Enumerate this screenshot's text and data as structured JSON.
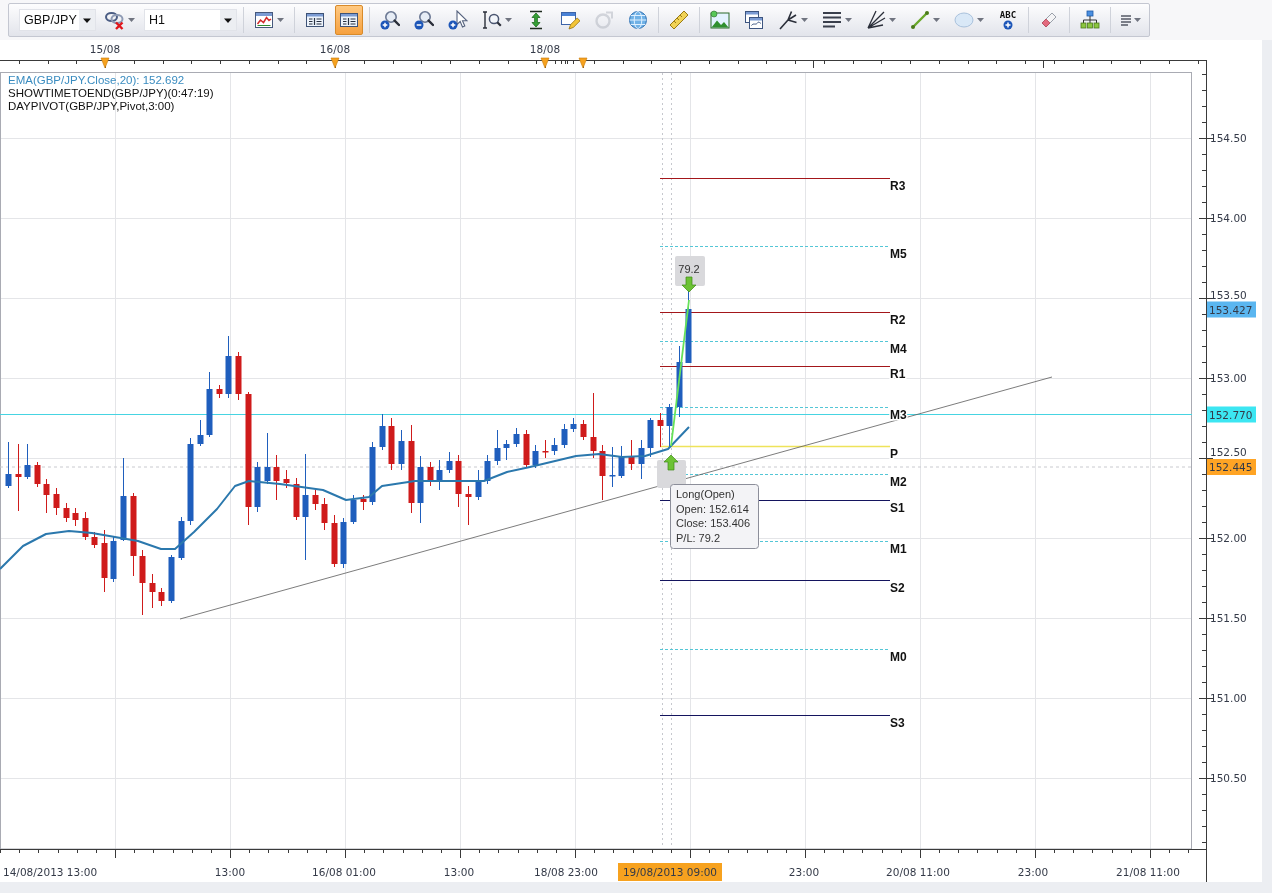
{
  "toolbar": {
    "groups": [
      {
        "items": [
          {
            "kind": "combo",
            "value": "GBP/JPY"
          },
          {
            "kind": "button",
            "on": false,
            "disabled": false,
            "menu": true
          },
          {
            "kind": "combo",
            "value": "H1"
          }
        ]
      },
      {
        "items": [
          {
            "kind": "button",
            "on": false,
            "disabled": false,
            "menu": true
          }
        ]
      },
      {
        "items": [
          {
            "kind": "button",
            "on": false,
            "disabled": false,
            "menu": false
          },
          {
            "kind": "button",
            "on": true,
            "disabled": false,
            "menu": false
          }
        ]
      },
      {
        "items": [
          {
            "kind": "button",
            "on": false,
            "disabled": false,
            "menu": false
          },
          {
            "kind": "button",
            "on": false,
            "disabled": false,
            "menu": false
          },
          {
            "kind": "button",
            "on": false,
            "disabled": false,
            "menu": false
          },
          {
            "kind": "button",
            "on": false,
            "disabled": false,
            "menu": true
          },
          {
            "kind": "button",
            "on": false,
            "disabled": false,
            "menu": false
          },
          {
            "kind": "button",
            "on": false,
            "disabled": false,
            "menu": false
          },
          {
            "kind": "button",
            "on": false,
            "disabled": true,
            "menu": false
          },
          {
            "kind": "button",
            "on": false,
            "disabled": false,
            "menu": false
          }
        ]
      },
      {
        "items": [
          {
            "kind": "button",
            "on": false,
            "disabled": false,
            "menu": false
          }
        ]
      },
      {
        "items": [
          {
            "kind": "button",
            "on": false,
            "disabled": false,
            "menu": false
          },
          {
            "kind": "button",
            "on": false,
            "disabled": false,
            "menu": false
          },
          {
            "kind": "button",
            "on": false,
            "disabled": false,
            "menu": true
          },
          {
            "kind": "button",
            "on": false,
            "disabled": false,
            "menu": true
          },
          {
            "kind": "button",
            "on": false,
            "disabled": false,
            "menu": true
          },
          {
            "kind": "button",
            "on": false,
            "disabled": false,
            "menu": true
          },
          {
            "kind": "button",
            "on": false,
            "disabled": false,
            "menu": true
          },
          {
            "kind": "button",
            "on": false,
            "disabled": false,
            "menu": false,
            "label": "ABC"
          }
        ]
      },
      {
        "items": [
          {
            "kind": "button",
            "on": false,
            "disabled": false,
            "menu": false
          }
        ]
      },
      {
        "items": [
          {
            "kind": "button",
            "on": false,
            "disabled": false,
            "menu": false
          }
        ]
      },
      {
        "items": [
          {
            "kind": "button",
            "on": false,
            "disabled": false,
            "menu": true
          }
        ]
      }
    ]
  },
  "date_ruler": {
    "labels": [
      "15/08",
      "16/08",
      "18/08"
    ]
  },
  "legend": [
    {
      "text": "EMA(GBP/JPY.Close,20): 152.692",
      "color": "#3a8cc0"
    },
    {
      "text": "SHOWTIMETOEND(GBP/JPY)(0:47:19)",
      "color": "#111111"
    },
    {
      "text": "DAYPIVOT(GBP/JPY,Pivot,3:00)",
      "color": "#111111"
    }
  ],
  "pivot_levels": [
    {
      "label": "R3",
      "kind": "resistance"
    },
    {
      "label": "M5",
      "kind": "mid"
    },
    {
      "label": "R2",
      "kind": "resistance"
    },
    {
      "label": "M4",
      "kind": "mid"
    },
    {
      "label": "R1",
      "kind": "resistance"
    },
    {
      "label": "M3",
      "kind": "mid"
    },
    {
      "label": "P",
      "kind": "pivot"
    },
    {
      "label": "M2",
      "kind": "mid"
    },
    {
      "label": "S1",
      "kind": "support"
    },
    {
      "label": "M1",
      "kind": "mid"
    },
    {
      "label": "S2",
      "kind": "support"
    },
    {
      "label": "M0",
      "kind": "mid"
    },
    {
      "label": "S3",
      "kind": "support"
    }
  ],
  "trade": {
    "profit": "79.2",
    "tooltip": [
      "Long(Open)",
      "Open: 152.614",
      "Close: 153.406",
      "P/L: 79.2"
    ]
  },
  "price_axis": {
    "ticks": [
      "154.50",
      "154.00",
      "153.50",
      "153.00",
      "152.50",
      "152.00",
      "151.50",
      "151.00",
      "150.50"
    ],
    "tags": [
      {
        "text": "153.427",
        "color": "#5ab6f0"
      },
      {
        "text": "152.770",
        "color": "#3ce6f2"
      },
      {
        "text": "152.445",
        "color": "#ffa424"
      }
    ]
  },
  "time_axis": {
    "labels": [
      {
        "text": "14/08/2013 13:00",
        "current": false
      },
      {
        "text": "13:00",
        "current": false
      },
      {
        "text": "16/08 01:00",
        "current": false
      },
      {
        "text": "13:00",
        "current": false
      },
      {
        "text": "18/08 23:00",
        "current": false
      },
      {
        "text": "19/08/2013 09:00",
        "current": true
      },
      {
        "text": "23:00",
        "current": false
      },
      {
        "text": "20/08 11:00",
        "current": false
      },
      {
        "text": "23:00",
        "current": false
      },
      {
        "text": "21/08 11:00",
        "current": false
      }
    ]
  }
}
